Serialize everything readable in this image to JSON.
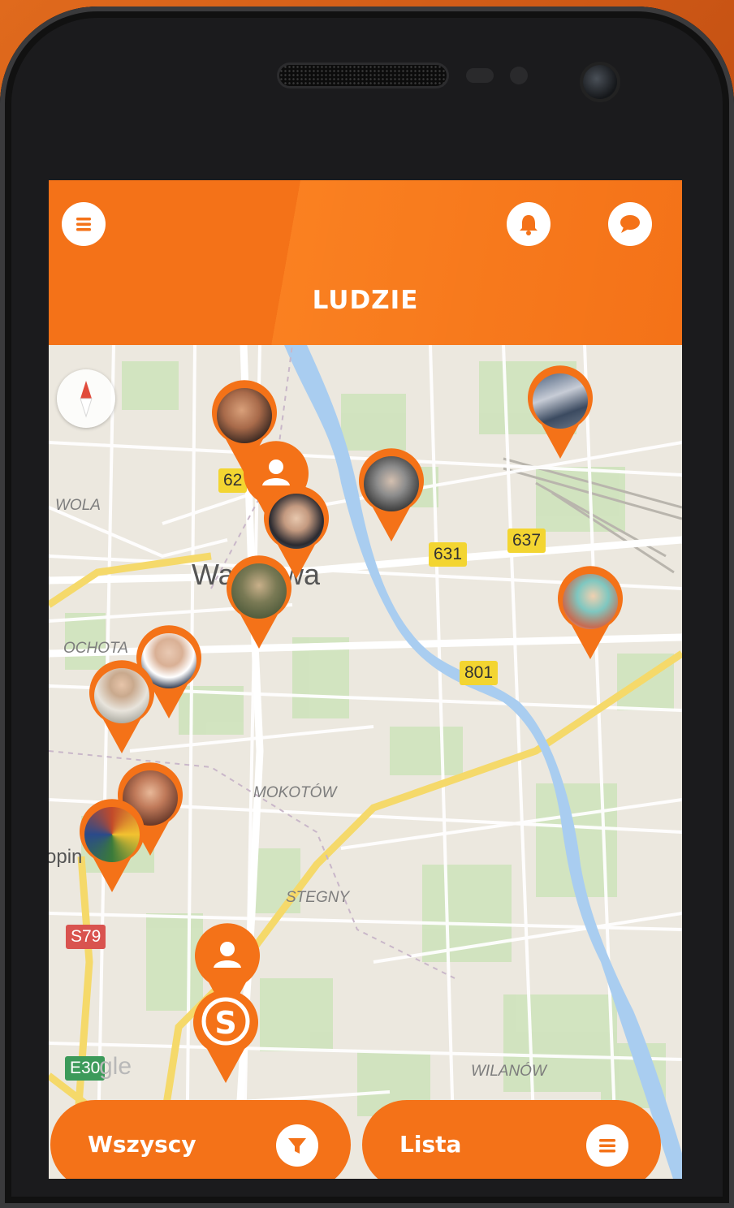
{
  "app": {
    "title": "LUDZIE",
    "accent_color": "#f47218"
  },
  "header": {
    "menu_icon": "menu-icon",
    "notification_icon": "bell-icon",
    "chat_icon": "chat-bubble-icon"
  },
  "map": {
    "district_labels": [
      "WOLA",
      "OCHOTA",
      "MOKOTÓW",
      "STEGNY",
      "WILANÓW"
    ],
    "city_label_left": "Wa",
    "city_label_right": "wa",
    "partial_label": "opin",
    "road_signs": [
      "62",
      "631",
      "637",
      "801"
    ],
    "route_signs": [
      "S79",
      "E30"
    ],
    "watermark_partial": "gle"
  },
  "bottom_bar": {
    "filter_label": "Wszyscy",
    "filter_icon": "funnel-icon",
    "list_label": "Lista",
    "list_icon": "list-icon"
  }
}
